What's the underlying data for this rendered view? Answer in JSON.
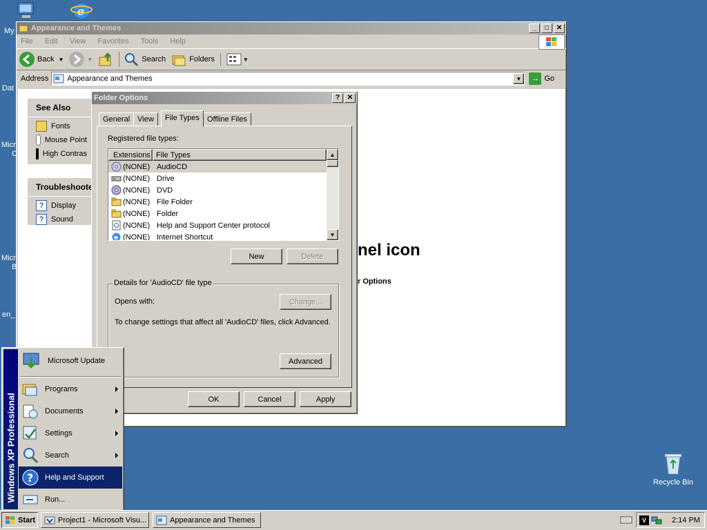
{
  "desktop": {
    "labels": {
      "my": "My",
      "dat": "Dat",
      "micro1": "Micro",
      "micro1b": "C",
      "micro2": "Micro",
      "micro2b": "B",
      "en": "en_"
    },
    "recycle_bin": "Recycle Bin"
  },
  "explorer": {
    "title": "Appearance and Themes",
    "menu": [
      "File",
      "Edit",
      "View",
      "Favorites",
      "Tools",
      "Help"
    ],
    "toolbar": {
      "back": "Back",
      "search": "Search",
      "folders": "Folders"
    },
    "address": {
      "label": "Address",
      "value": "Appearance and Themes",
      "go": "Go"
    },
    "see_also": {
      "title": "See Also",
      "items": [
        "Fonts",
        "Mouse Point",
        "High Contras"
      ]
    },
    "troubleshooters": {
      "title": "Troubleshoote",
      "items": [
        "Display",
        "Sound"
      ]
    },
    "bg_heading": "nel icon",
    "bg_sub": "r Options"
  },
  "folder_options": {
    "title": "Folder Options",
    "help_btn": "?",
    "close_btn": "✕",
    "tabs": [
      "General",
      "View",
      "File Types",
      "Offline Files"
    ],
    "active_tab": "File Types",
    "registered_label": "Registered file types:",
    "columns": [
      "Extensions",
      "File Types"
    ],
    "rows": [
      {
        "ext": "(NONE)",
        "type": "AudioCD",
        "icon": "cd-icon"
      },
      {
        "ext": "(NONE)",
        "type": "Drive",
        "icon": "drive-icon"
      },
      {
        "ext": "(NONE)",
        "type": "DVD",
        "icon": "dvd-icon"
      },
      {
        "ext": "(NONE)",
        "type": "File Folder",
        "icon": "folder-icon"
      },
      {
        "ext": "(NONE)",
        "type": "Folder",
        "icon": "folder-icon"
      },
      {
        "ext": "(NONE)",
        "type": "Help and Support Center protocol",
        "icon": "help-protocol-icon"
      },
      {
        "ext": "(NONE)",
        "type": "Internet Shortcut",
        "icon": "ie-icon"
      }
    ],
    "new_btn": "New",
    "delete_btn": "Delete",
    "details_label": "Details for 'AudioCD' file type",
    "opens_with": "Opens with:",
    "change_btn": "Change...",
    "info_text": "To change settings that affect all 'AudioCD' files, click Advanced.",
    "advanced_btn": "Advanced",
    "ok_btn": "OK",
    "cancel_btn": "Cancel",
    "apply_btn": "Apply"
  },
  "start_menu": {
    "banner": "Windows XP Professional",
    "items": [
      {
        "label": "Microsoft Update",
        "arrow": false
      },
      {
        "label": "Programs",
        "arrow": true
      },
      {
        "label": "Documents",
        "arrow": true
      },
      {
        "label": "Settings",
        "arrow": true
      },
      {
        "label": "Search",
        "arrow": true
      },
      {
        "label": "Help and Support",
        "arrow": false
      },
      {
        "label": "Run...",
        "arrow": false
      }
    ],
    "highlighted": "Help and Support"
  },
  "taskbar": {
    "start": "Start",
    "tasks": [
      "Project1 - Microsoft Visu...",
      "Appearance and Themes"
    ],
    "clock": "2:14 PM"
  },
  "colors": {
    "desktop": "#3a6ea5",
    "face": "#d4d0c8",
    "highlight": "#0a246a"
  }
}
